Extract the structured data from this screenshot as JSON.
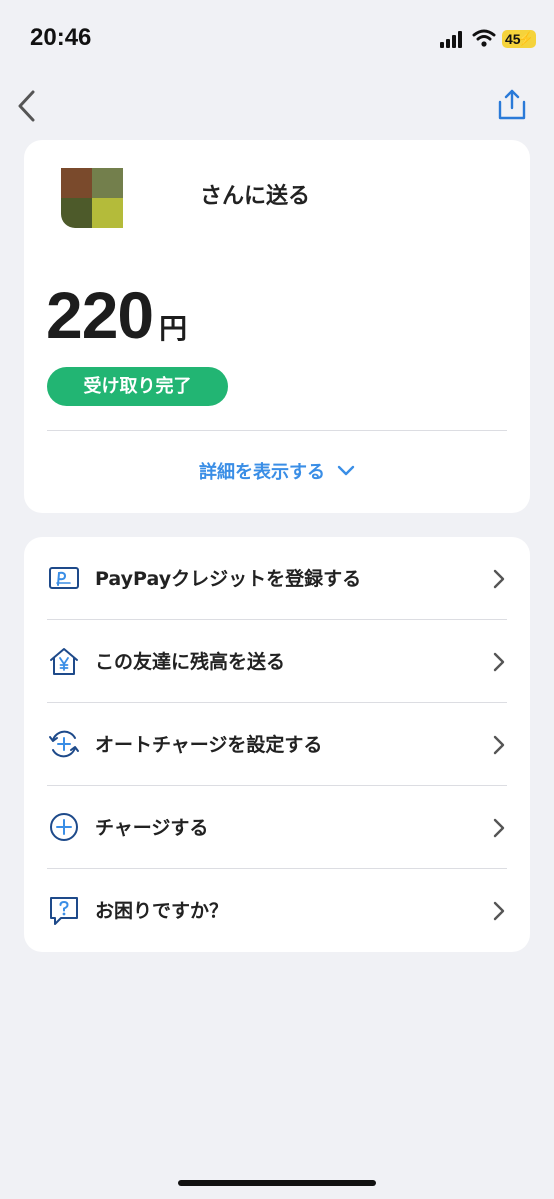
{
  "status_bar": {
    "time": "20:46",
    "battery": "45",
    "battery_color": "#f5d33b"
  },
  "nav": {
    "back_icon": "chevron-left-icon",
    "share_icon": "share-icon"
  },
  "transfer": {
    "recipient_suffix": "さんに送る",
    "amount": "220",
    "currency": "円",
    "status": "受け取り完了",
    "status_color": "#22b573",
    "details_label": "詳細を表示する"
  },
  "menu": {
    "items": [
      {
        "label": "PayPayクレジットを登録する",
        "icon": "credit-card-icon"
      },
      {
        "label": "この友達に残高を送る",
        "icon": "yen-house-icon"
      },
      {
        "label": "オートチャージを設定する",
        "icon": "auto-charge-icon"
      },
      {
        "label": "チャージする",
        "icon": "plus-circle-icon"
      },
      {
        "label": "お困りですか？",
        "icon": "help-chat-icon"
      }
    ]
  },
  "colors": {
    "accent_blue": "#3a8ee6",
    "background": "#f0f1f5"
  }
}
